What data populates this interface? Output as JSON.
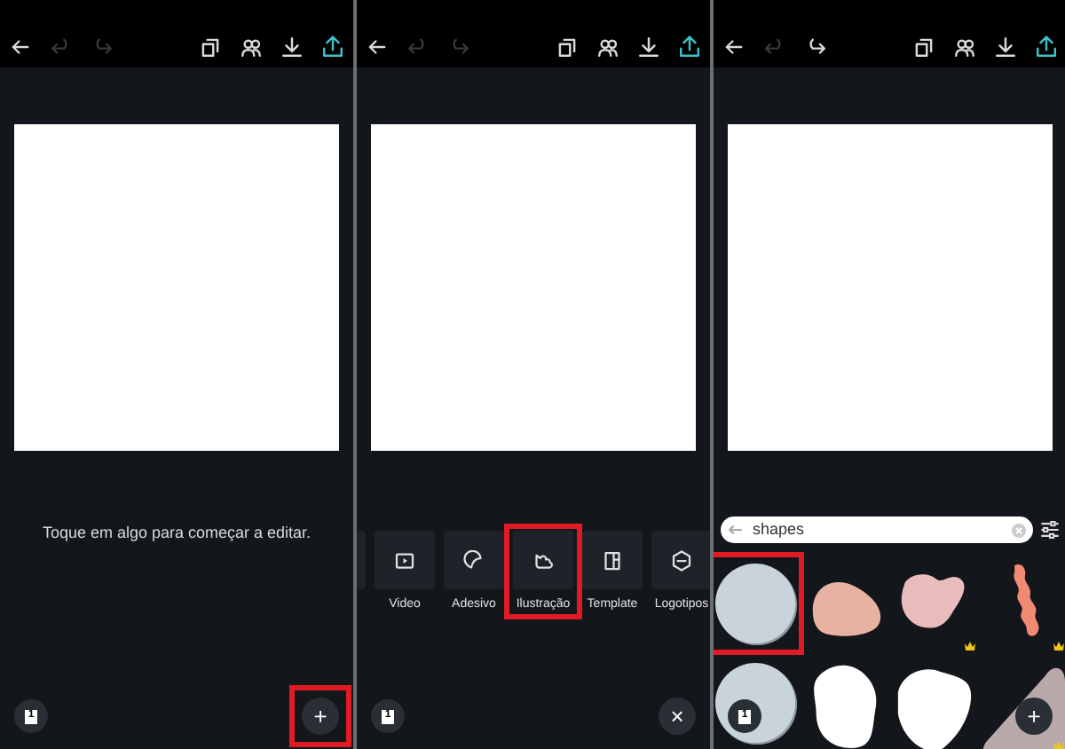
{
  "panels": [
    {
      "toolbar": {
        "undo_disabled": true,
        "redo_disabled": true
      },
      "kind": "hint",
      "hint": "Toque em algo para começar a editar.",
      "page_number": "1",
      "fab": {
        "symbol": "+",
        "highlighted": true
      }
    },
    {
      "toolbar": {
        "undo_disabled": true,
        "redo_disabled": true
      },
      "kind": "menu",
      "menu": [
        {
          "label": "Video",
          "highlighted": false
        },
        {
          "label": "Adesivo",
          "highlighted": false
        },
        {
          "label": "Ilustração",
          "highlighted": true
        },
        {
          "label": "Template",
          "highlighted": false
        },
        {
          "label": "Logotipos",
          "highlighted": false
        }
      ],
      "page_number": "1",
      "fab": {
        "symbol": "×",
        "highlighted": false
      }
    },
    {
      "toolbar": {
        "undo_disabled": true,
        "redo_disabled": false
      },
      "kind": "shapes",
      "search": {
        "value": "shapes"
      },
      "shapes": [
        {
          "kind": "circle",
          "color": "#c9d3dc",
          "premium": false,
          "highlighted": true
        },
        {
          "kind": "blob",
          "color": "#e8b2a2",
          "premium": false,
          "highlighted": false
        },
        {
          "kind": "blob2",
          "color": "#e9bdbd",
          "premium": true,
          "highlighted": false
        },
        {
          "kind": "squiggle",
          "color": "#f08a72",
          "premium": true,
          "highlighted": false
        },
        {
          "kind": "circle",
          "color": "#c9d3dc",
          "premium": false,
          "highlighted": false
        },
        {
          "kind": "blob3",
          "color": "#ffffff",
          "premium": false,
          "highlighted": false
        },
        {
          "kind": "blob4",
          "color": "#ffffff",
          "premium": false,
          "highlighted": false
        },
        {
          "kind": "triangle",
          "color": "#b8a8aa",
          "premium": true,
          "highlighted": false
        }
      ],
      "page_number": "1",
      "fab": {
        "symbol": "+",
        "highlighted": false
      }
    }
  ]
}
